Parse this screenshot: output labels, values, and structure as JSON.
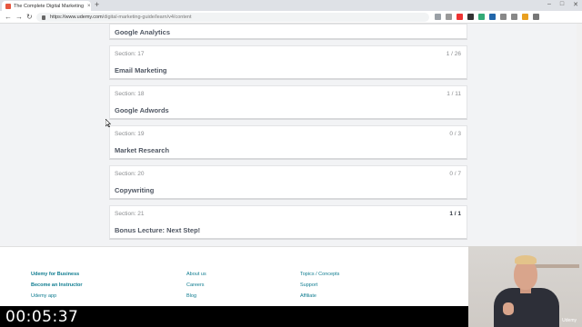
{
  "browser": {
    "tab_title": "The Complete Digital Marketing",
    "tab_close": "×",
    "new_tab": "+",
    "url_domain": "https://www.udemy.com",
    "url_path": "/digital-marketing-guide/learn/v4/content"
  },
  "sections": [
    {
      "title": "Google Analytics"
    },
    {
      "section": "Section: 17",
      "title": "Email Marketing",
      "progress": "1 / 26"
    },
    {
      "section": "Section: 18",
      "title": "Google Adwords",
      "progress": "1 / 11"
    },
    {
      "section": "Section: 19",
      "title": "Market Research",
      "progress": "0 / 3"
    },
    {
      "section": "Section: 20",
      "title": "Copywriting",
      "progress": "0 / 7"
    },
    {
      "section": "Section: 21",
      "title": "Bonus Lecture: Next Step!",
      "progress": "1 / 1"
    }
  ],
  "footer": {
    "col1": [
      "Udemy for Business",
      "Become an Instructor",
      "Udemy app"
    ],
    "col2": [
      "About us",
      "Careers",
      "Blog"
    ],
    "col3": [
      "Topics / Concepts",
      "Support",
      "Affiliate"
    ]
  },
  "timer": "00:05:37",
  "webcam_logo": "Udemy"
}
